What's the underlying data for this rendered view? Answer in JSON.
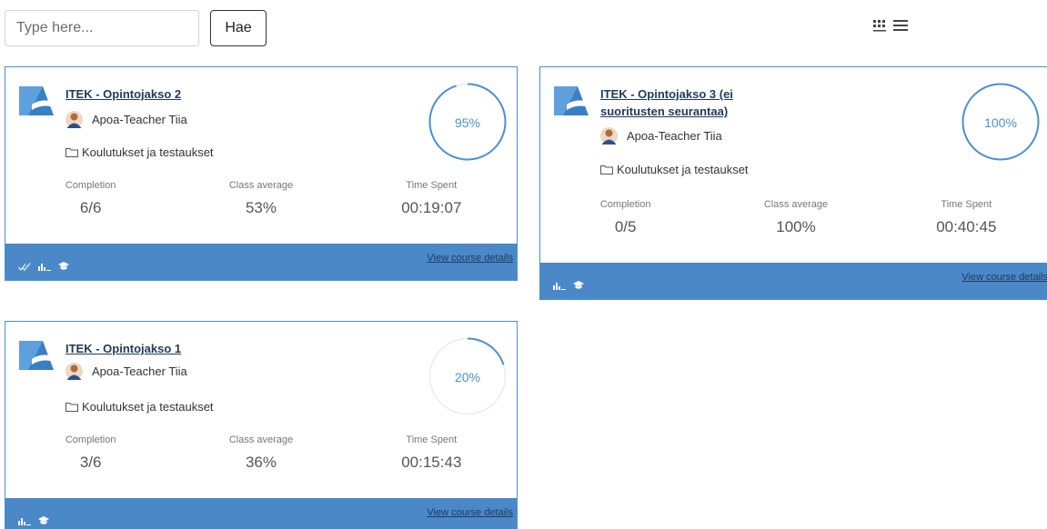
{
  "search": {
    "placeholder": "Type here...",
    "button_label": "Hae"
  },
  "view_toggle": {
    "icons": [
      "grid-view-icon",
      "list-view-icon"
    ]
  },
  "colors": {
    "accent": "#4a90d2",
    "footer": "#4a88c8",
    "title": "#1f3a5a"
  },
  "labels": {
    "completion": "Completion",
    "class_average": "Class average",
    "time_spent": "Time Spent",
    "view_details": "View course details"
  },
  "courses": [
    {
      "title": "ITEK - Opintojakso 2",
      "teacher": "Apoa-Teacher Tiia",
      "category": "Koulutukset ja testaukset",
      "progress": 95,
      "progress_label": "95%",
      "completion": "6/6",
      "class_average": "53%",
      "time_spent": "00:19:07",
      "footer_icons": [
        "completion-check-icon",
        "bar-chart-icon",
        "graduation-cap-icon"
      ]
    },
    {
      "title_line1": "ITEK - Opintojakso 3 (ei",
      "title_line2": "suoritusten seurantaa)",
      "teacher": "Apoa-Teacher Tiia",
      "category": "Koulutukset ja testaukset",
      "progress": 100,
      "progress_label": "100%",
      "completion": "0/5",
      "class_average": "100%",
      "time_spent": "00:40:45",
      "footer_icons": [
        "bar-chart-icon",
        "graduation-cap-icon"
      ]
    },
    {
      "title": "ITEK - Opintojakso 1",
      "teacher": "Apoa-Teacher Tiia",
      "category": "Koulutukset ja testaukset",
      "progress": 20,
      "progress_label": "20%",
      "completion": "3/6",
      "class_average": "36%",
      "time_spent": "00:15:43",
      "footer_icons": [
        "bar-chart-icon",
        "graduation-cap-icon"
      ]
    }
  ]
}
